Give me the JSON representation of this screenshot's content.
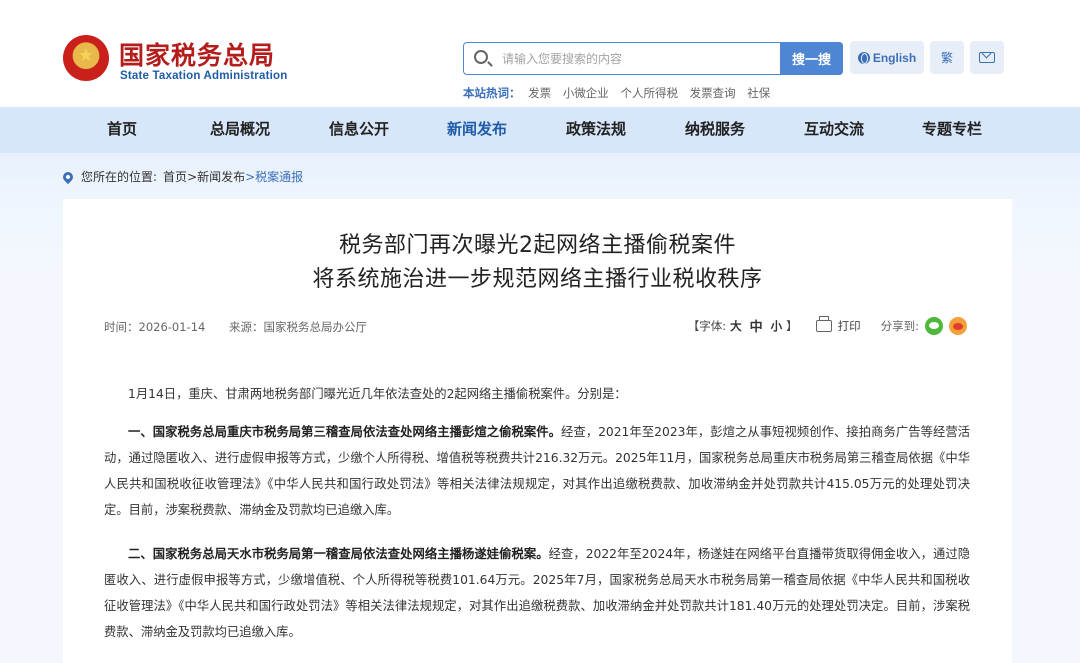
{
  "header": {
    "logo_cn": "国家税务总局",
    "logo_en": "State Taxation Administration",
    "search": {
      "placeholder": "请输入您要搜索的内容",
      "button": "搜一搜"
    },
    "english_label": "English",
    "traditional_label": "繁",
    "hot": {
      "label": "本站热词：",
      "items": [
        "发票",
        "小微企业",
        "个人所得税",
        "发票查询",
        "社保"
      ]
    }
  },
  "nav": {
    "items": [
      "首页",
      "总局概况",
      "信息公开",
      "新闻发布",
      "政策法规",
      "纳税服务",
      "互动交流",
      "专题专栏"
    ],
    "active": "新闻发布"
  },
  "breadcrumb": {
    "label": "您所在的位置:",
    "path": [
      "首页",
      ">新闻发布",
      ">税案通报"
    ]
  },
  "article": {
    "title_line1": "税务部门再次曝光2起网络主播偷税案件",
    "title_line2": "将系统施治进一步规范网络主播行业税收秩序",
    "time": "时间：2026-01-14",
    "source": "来源：国家税务总局办公厅",
    "font_size": {
      "prefix": "【字体:",
      "large": "大",
      "medium": "中",
      "small": "小",
      "suffix": "】"
    },
    "print_label": "打印",
    "share_label": "分享到:",
    "intro": "1月14日，重庆、甘肃两地税务部门曝光近几年依法查处的2起网络主播偷税案件。分别是：",
    "case1_head": "一、国家税务总局重庆市税务局第三稽查局依法查处网络主播彭煊之偷税案件。",
    "case1_body": "经查，2021年至2023年，彭煊之从事短视频创作、接拍商务广告等经营活动，通过隐匿收入、进行虚假申报等方式，少缴个人所得税、增值税等税费共计216.32万元。2025年11月，国家税务总局重庆市税务局第三稽查局依据《中华人民共和国税收征收管理法》《中华人民共和国行政处罚法》等相关法律法规规定，对其作出追缴税费款、加收滞纳金并处罚款共计415.05万元的处理处罚决定。目前，涉案税费款、滞纳金及罚款均已追缴入库。",
    "case2_head": "二、国家税务总局天水市税务局第一稽查局依法查处网络主播杨遂娃偷税案。",
    "case2_body": "经查，2022年至2024年，杨遂娃在网络平台直播带货取得佣金收入，通过隐匿收入、进行虚假申报等方式，少缴增值税、个人所得税等税费101.64万元。2025年7月，国家税务总局天水市税务局第一稽查局依据《中华人民共和国税收征收管理法》《中华人民共和国行政处罚法》等相关法律法规规定，对其作出追缴税费款、加收滞纳金并处罚款共计181.40万元的处理处罚决定。目前，涉案税费款、滞纳金及罚款均已追缴入库。"
  },
  "colors": {
    "brand_red": "#b51c1c",
    "brand_blue": "#1f5ca8",
    "nav_bg": "#d7e6f9",
    "button_blue": "#4e86d4"
  }
}
